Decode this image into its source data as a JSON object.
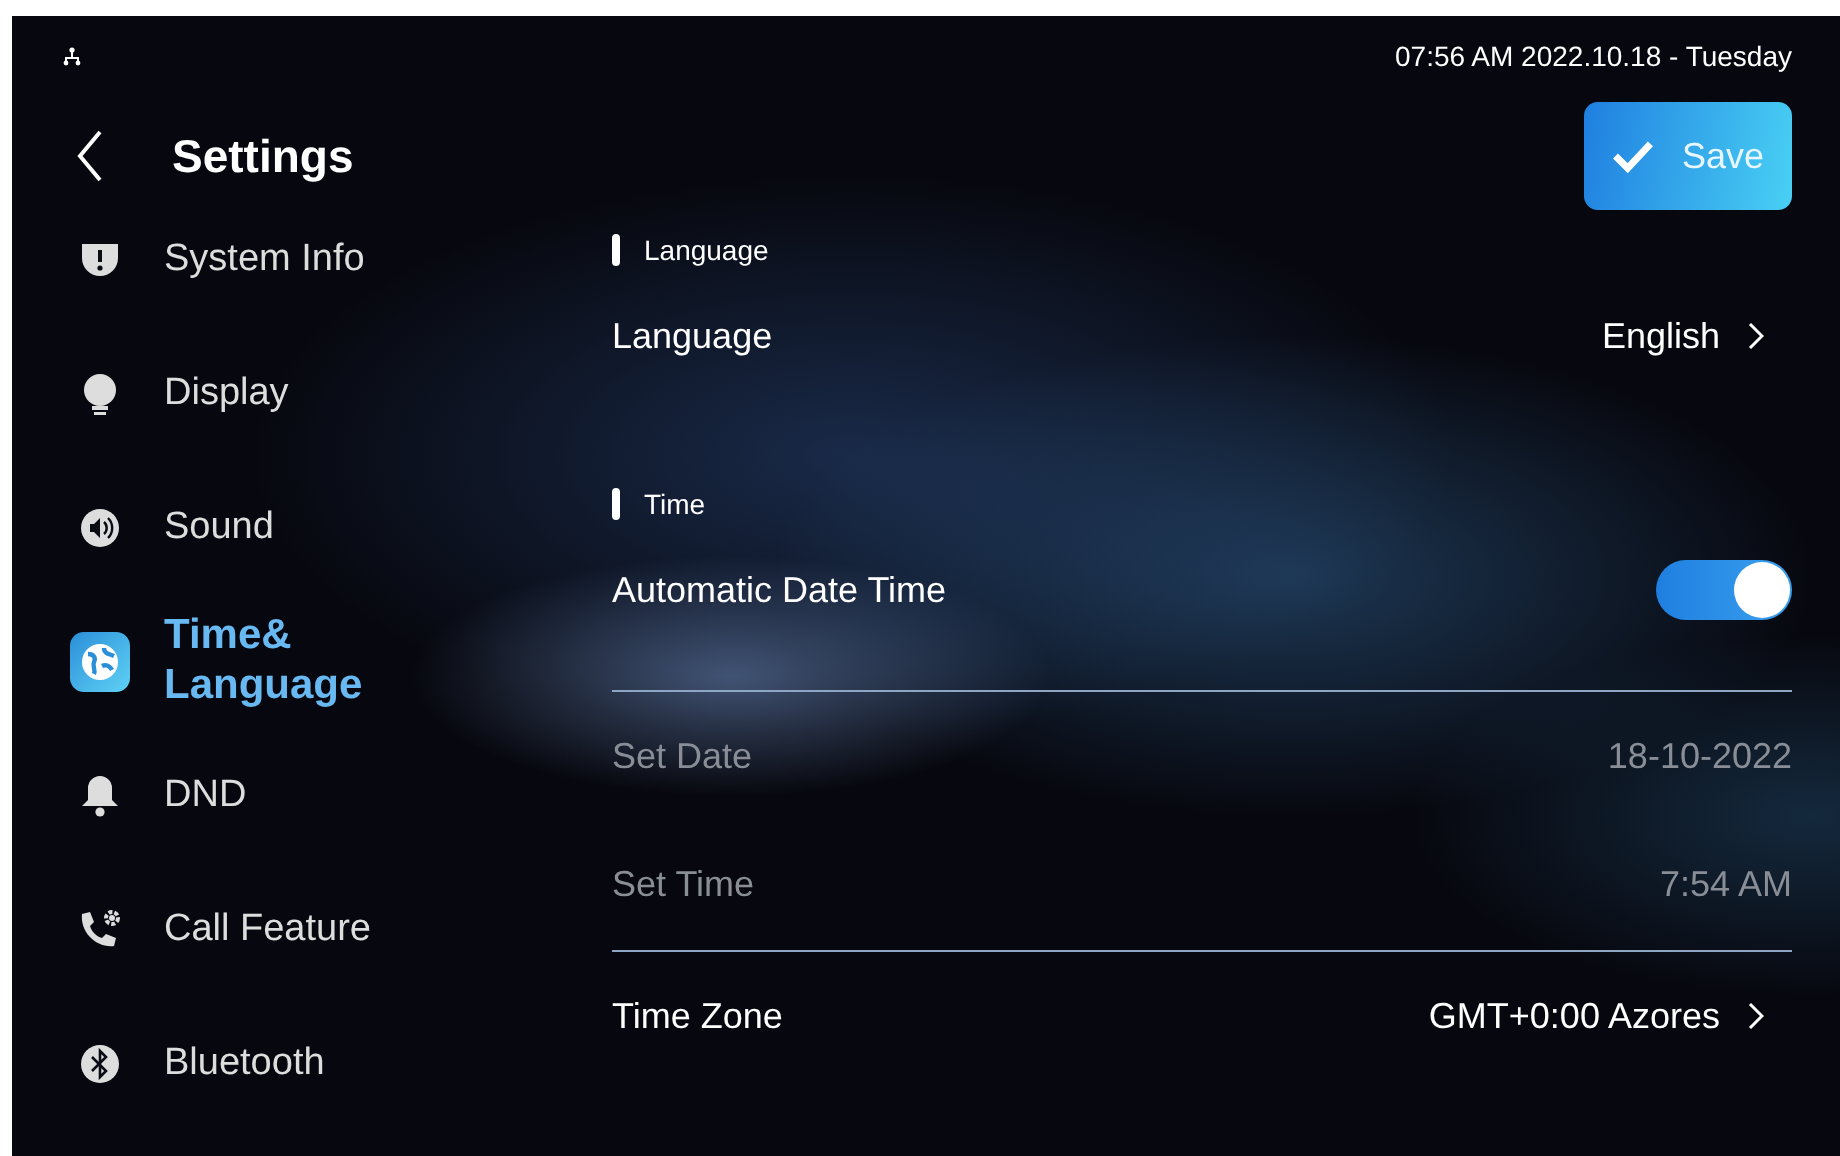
{
  "status_bar": {
    "datetime": "07:56 AM  2022.10.18 - Tuesday"
  },
  "header": {
    "title": "Settings",
    "save": "Save"
  },
  "sidebar": {
    "items": [
      {
        "label": "System Info",
        "selected": false
      },
      {
        "label": "Display",
        "selected": false
      },
      {
        "label": "Sound",
        "selected": false
      },
      {
        "label": "Time&\nLanguage",
        "selected": true
      },
      {
        "label": "DND",
        "selected": false
      },
      {
        "label": "Call Feature",
        "selected": false
      },
      {
        "label": "Bluetooth",
        "selected": false
      }
    ]
  },
  "content": {
    "rows": [
      {
        "kind": "section",
        "label": "Language"
      },
      {
        "kind": "link",
        "label": "Language",
        "value": "English"
      },
      {
        "kind": "section",
        "label": "Time"
      },
      {
        "kind": "toggle",
        "label": "Automatic Date Time",
        "on": true
      },
      {
        "kind": "divider"
      },
      {
        "kind": "value",
        "label": "Set Date",
        "value": "18-10-2022",
        "disabled": true
      },
      {
        "kind": "value",
        "label": "Set Time",
        "value": "7:54 AM",
        "disabled": true
      },
      {
        "kind": "divider"
      },
      {
        "kind": "link",
        "label": "Time Zone",
        "value": "GMT+0:00 Azores"
      }
    ]
  }
}
